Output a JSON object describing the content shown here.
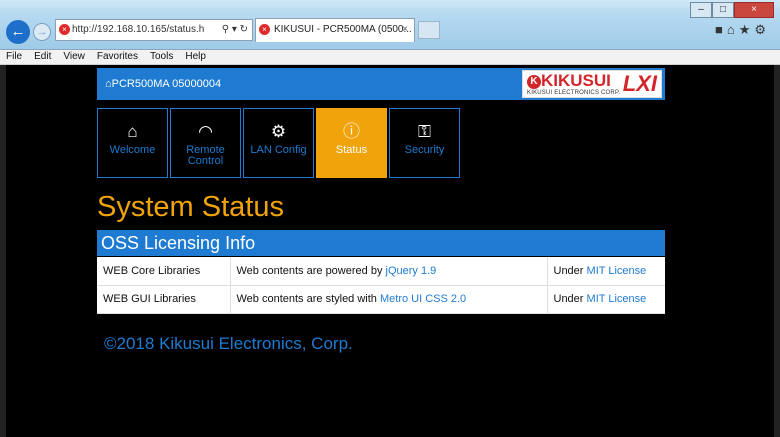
{
  "browser": {
    "address": "http://192.168.10.165/status.h",
    "tab_title": "KIKUSUI - PCR500MA (0500...",
    "menu": [
      "File",
      "Edit",
      "View",
      "Favorites",
      "Tools",
      "Help"
    ]
  },
  "header": {
    "device": "PCR500MA 05000004",
    "logo_brand": "KIKUSUI",
    "logo_sub": "KIKUSUI ELECTRONICS CORP.",
    "logo_lxi": "LXI"
  },
  "nav": [
    {
      "label": "Welcome",
      "icon": "home-icon",
      "active": false
    },
    {
      "label": "Remote Control",
      "icon": "gauge-icon",
      "active": false
    },
    {
      "label": "LAN Config",
      "icon": "gear-icon",
      "active": false
    },
    {
      "label": "Status",
      "icon": "info-icon",
      "active": true
    },
    {
      "label": "Security",
      "icon": "key-icon",
      "active": false
    }
  ],
  "page_title": "System Status",
  "section_title": "OSS Licensing Info",
  "table": [
    {
      "name": "WEB Core Libraries",
      "desc_prefix": "Web contents are powered by ",
      "desc_link": "jQuery 1.9",
      "lic_prefix": "Under ",
      "lic_link": "MIT License"
    },
    {
      "name": "WEB GUI Libraries",
      "desc_prefix": "Web contents are styled with ",
      "desc_link": "Metro UI CSS 2.0",
      "lic_prefix": "Under ",
      "lic_link": "MIT License"
    }
  ],
  "footer": "©2018 Kikusui Electronics, Corp.",
  "colors": {
    "accent": "#1e7bd1",
    "active_tile": "#f0a30a",
    "brand_red": "#d3262a"
  }
}
